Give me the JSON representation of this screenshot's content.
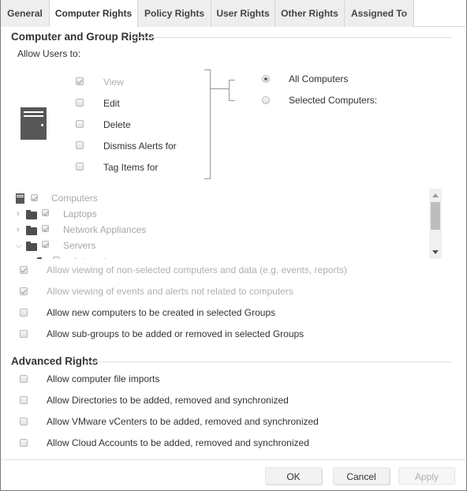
{
  "tabs": [
    {
      "label": "General",
      "active": false
    },
    {
      "label": "Computer Rights",
      "active": true
    },
    {
      "label": "Policy Rights",
      "active": false
    },
    {
      "label": "User Rights",
      "active": false
    },
    {
      "label": "Other Rights",
      "active": false
    },
    {
      "label": "Assigned To",
      "active": false
    }
  ],
  "computer_group_rights": {
    "title": "Computer and Group Rights",
    "allow_users_label": "Allow Users to:",
    "icon": "computer-icon",
    "permissions": [
      {
        "label": "View",
        "checked": true,
        "disabled": true
      },
      {
        "label": "Edit",
        "checked": false,
        "disabled": false
      },
      {
        "label": "Delete",
        "checked": false,
        "disabled": false
      },
      {
        "label": "Dismiss Alerts for",
        "checked": false,
        "disabled": false
      },
      {
        "label": "Tag Items for",
        "checked": false,
        "disabled": false
      }
    ],
    "scope": [
      {
        "label": "All Computers",
        "selected": true
      },
      {
        "label": "Selected Computers:",
        "selected": false
      }
    ],
    "tree": [
      {
        "label": "Computers",
        "level": 0,
        "icon": "computer-icon",
        "expander": "none",
        "checked": true
      },
      {
        "label": "Laptops",
        "level": 1,
        "icon": "folder-icon",
        "expander": "collapsed",
        "checked": true
      },
      {
        "label": "Network Appliances",
        "level": 1,
        "icon": "folder-icon",
        "expander": "collapsed",
        "checked": true
      },
      {
        "label": "Servers",
        "level": 1,
        "icon": "folder-icon",
        "expander": "expanded",
        "checked": true
      },
      {
        "label": "Internet",
        "level": 2,
        "icon": "folder-icon",
        "expander": "collapsed",
        "checked": true
      }
    ],
    "options": [
      {
        "label": "Allow viewing of non-selected computers and data (e.g. events, reports)",
        "checked": true,
        "disabled": true
      },
      {
        "label": "Allow viewing of events and alerts not related to computers",
        "checked": true,
        "disabled": true
      },
      {
        "label": "Allow new computers to be created in selected Groups",
        "checked": false,
        "disabled": false
      },
      {
        "label": "Allow sub-groups to be added or removed in selected Groups",
        "checked": false,
        "disabled": false
      }
    ]
  },
  "advanced_rights": {
    "title": "Advanced Rights",
    "options": [
      {
        "label": "Allow computer file imports",
        "checked": false
      },
      {
        "label": "Allow Directories to be added, removed and synchronized",
        "checked": false
      },
      {
        "label": "Allow VMware vCenters to be added, removed and synchronized",
        "checked": false
      },
      {
        "label": "Allow Cloud Accounts to be added, removed and synchronized",
        "checked": false
      }
    ]
  },
  "footer": {
    "ok_label": "OK",
    "cancel_label": "Cancel",
    "apply_label": "Apply",
    "apply_disabled": true
  }
}
